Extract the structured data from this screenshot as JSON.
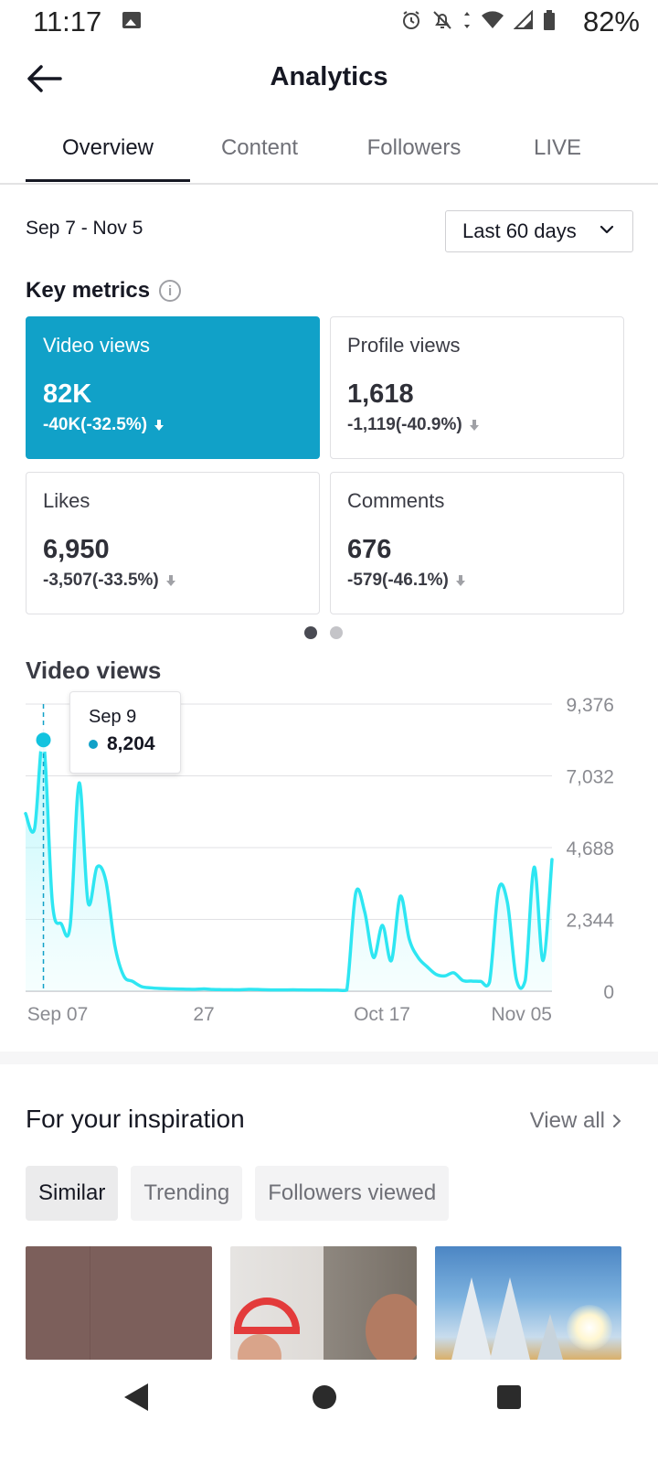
{
  "status_bar": {
    "time": "11:17",
    "battery": "82%"
  },
  "header": {
    "title": "Analytics"
  },
  "tabs": [
    {
      "label": "Overview",
      "active": true
    },
    {
      "label": "Content",
      "active": false
    },
    {
      "label": "Followers",
      "active": false
    },
    {
      "label": "LIVE",
      "active": false
    }
  ],
  "date_range": "Sep 7 - Nov 5",
  "period_select": {
    "value": "Last 60 days"
  },
  "key_metrics": {
    "title": "Key metrics",
    "cards": [
      {
        "label": "Video views",
        "value": "82K",
        "change": "-40K(-32.5%)",
        "active": true
      },
      {
        "label": "Profile views",
        "value": "1,618",
        "change": "-1,119(-40.9%)",
        "active": false
      },
      {
        "label": "Likes",
        "value": "6,950",
        "change": "-3,507(-33.5%)",
        "active": false
      },
      {
        "label": "Comments",
        "value": "676",
        "change": "-579(-46.1%)",
        "active": false
      }
    ]
  },
  "chart_title": "Video views",
  "tooltip": {
    "date": "Sep 9",
    "value": "8,204"
  },
  "colors": {
    "accent": "#11a1c8",
    "line": "#2ee6f2",
    "text": "#161823"
  },
  "chart_data": {
    "type": "area",
    "title": "Video views",
    "x_tick_labels": [
      "Sep 07",
      "27",
      "Oct 17",
      "Nov 05"
    ],
    "y_tick_labels": [
      "9,376",
      "7,032",
      "4,688",
      "2,344",
      "0"
    ],
    "ylim": [
      0,
      9376
    ],
    "grid": true,
    "highlight": {
      "x": "Sep 9",
      "y": 8204
    },
    "series": [
      {
        "values": [
          5800,
          5300,
          8204,
          2900,
          2200,
          2150,
          6800,
          2900,
          4050,
          3600,
          1500,
          500,
          320,
          150,
          110,
          90,
          80,
          70,
          65,
          60,
          75,
          55,
          50,
          48,
          45,
          60,
          55,
          45,
          40,
          42,
          44,
          40,
          38,
          36,
          35,
          35,
          36,
          3200,
          2600,
          1100,
          2150,
          1000,
          3100,
          1700,
          1100,
          800,
          550,
          500,
          600,
          350,
          330,
          320,
          300,
          3300,
          2900,
          400,
          350,
          4050,
          1000,
          4300
        ]
      }
    ]
  },
  "inspiration": {
    "title": "For your inspiration",
    "view_all": "View all",
    "chips": [
      {
        "label": "Similar",
        "active": true
      },
      {
        "label": "Trending",
        "active": false
      },
      {
        "label": "Followers viewed",
        "active": false
      }
    ]
  }
}
